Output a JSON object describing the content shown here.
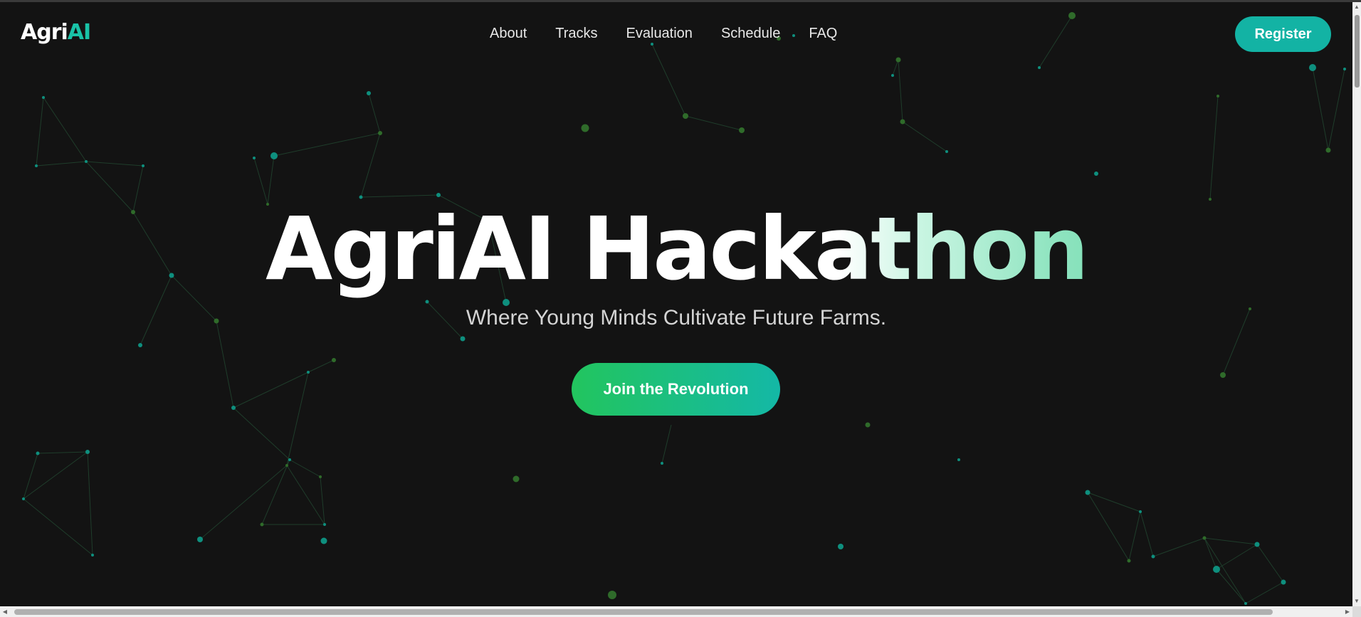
{
  "nav": {
    "logo_main": "Agri",
    "logo_accent": "AI",
    "links": [
      "About",
      "Tracks",
      "Evaluation",
      "Schedule",
      "FAQ"
    ],
    "register_label": "Register"
  },
  "hero": {
    "title": "AgriAI Hackathon",
    "subtitle": "Where Young Minds Cultivate Future Farms.",
    "cta_label": "Join the Revolution"
  },
  "colors": {
    "background": "#131313",
    "accent_teal": "#13b3a4",
    "accent_green": "#22c55e",
    "node_teal": "#0e8f7e",
    "node_green": "#2f6b2a"
  },
  "icons": {
    "scroll_up": "▲",
    "scroll_down": "▼",
    "scroll_left": "◀",
    "scroll_right": "▶"
  }
}
